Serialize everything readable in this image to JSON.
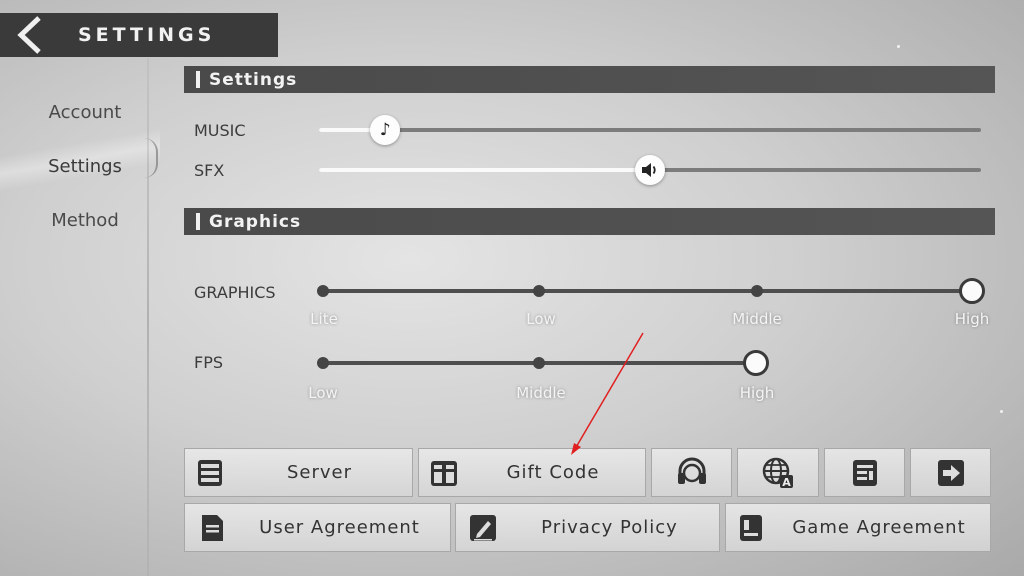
{
  "header": {
    "title": "SETTINGS"
  },
  "nav": {
    "items": [
      {
        "label": "Account",
        "active": false
      },
      {
        "label": "Settings",
        "active": true
      },
      {
        "label": "Method",
        "active": false
      }
    ]
  },
  "settings_section": {
    "title": "Settings",
    "music": {
      "label": "MUSIC",
      "level": 0.1,
      "icon": "music-note-icon"
    },
    "sfx": {
      "label": "SFX",
      "level": 0.5,
      "icon": "speaker-icon"
    }
  },
  "graphics_section": {
    "title": "Graphics",
    "graphics": {
      "label": "GRAPHICS",
      "options": [
        "Lite",
        "Low",
        "Middle",
        "High"
      ],
      "selected": "High"
    },
    "fps": {
      "label": "FPS",
      "options": [
        "Low",
        "Middle",
        "High"
      ],
      "selected": "High"
    }
  },
  "buttons": {
    "server": "Server",
    "gift_code": "Gift Code",
    "user_agreement": "User Agreement",
    "privacy_policy": "Privacy Policy",
    "game_agreement": "Game Agreement"
  },
  "colors": {
    "header_bg": "#3a3a3a",
    "section_bg": "#4a4a4a",
    "annotation_arrow": "#e02020"
  }
}
